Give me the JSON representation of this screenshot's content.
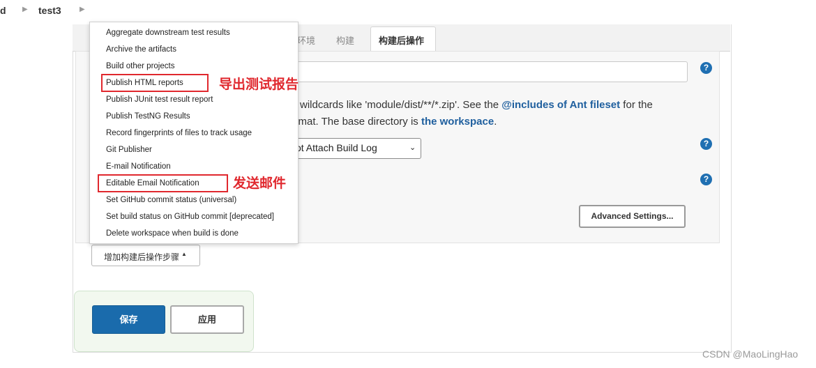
{
  "breadcrumb": {
    "partial": "d",
    "project": "test3"
  },
  "tabs": {
    "env": "环境",
    "build": "构建",
    "post_build": "构建后操作"
  },
  "form": {
    "desc_line1_pre": "se wildcards like 'module/dist/**/*.zip'. See the ",
    "desc_line1_link": "@includes of Ant fileset",
    "desc_line1_post": " for the",
    "desc_line2_pre": "format. The base directory is ",
    "desc_line2_link": "the workspace",
    "desc_line2_post": ".",
    "select_value": "ot Attach Build Log",
    "help": "?",
    "advanced_button": "Advanced Settings..."
  },
  "menu": {
    "items": [
      "Aggregate downstream test results",
      "Archive the artifacts",
      "Build other projects",
      "Publish HTML reports",
      "Publish JUnit test result report",
      "Publish TestNG Results",
      "Record fingerprints of files to track usage",
      "Git Publisher",
      "E-mail Notification",
      "Editable Email Notification",
      "Set GitHub commit status (universal)",
      "Set build status on GitHub commit [deprecated]",
      "Delete workspace when build is done"
    ]
  },
  "annotations": {
    "html_reports": "导出测试报告",
    "email": "发送邮件"
  },
  "add_step_button": "增加构建后操作步骤",
  "save_bar": {
    "save": "保存",
    "apply": "应用"
  },
  "watermark": "CSDN @MaoLingHao",
  "colors": {
    "accent": "#1a6bac",
    "annotation": "#e0282e",
    "link": "#1f5f9e"
  }
}
